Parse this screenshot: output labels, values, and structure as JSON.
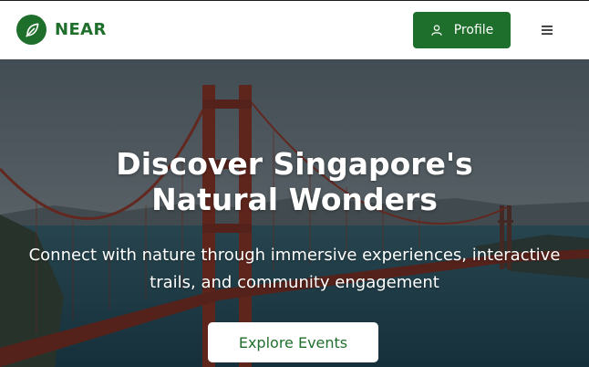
{
  "header": {
    "brand_name": "NEAR",
    "logo_icon": "leaf-icon",
    "profile_label": "Profile",
    "profile_icon": "user-icon",
    "menu_icon": "hamburger-menu-icon"
  },
  "hero": {
    "title_line1": "Discover Singapore's",
    "title_line2": "Natural Wonders",
    "subtitle_line1": "Connect with nature through immersive experiences, interactive",
    "subtitle_line2": "trails, and community engagement",
    "cta_label": "Explore Events",
    "background": "golden-gate-bridge-photo"
  },
  "colors": {
    "brand_green": "#1f6f2c",
    "white": "#ffffff"
  }
}
